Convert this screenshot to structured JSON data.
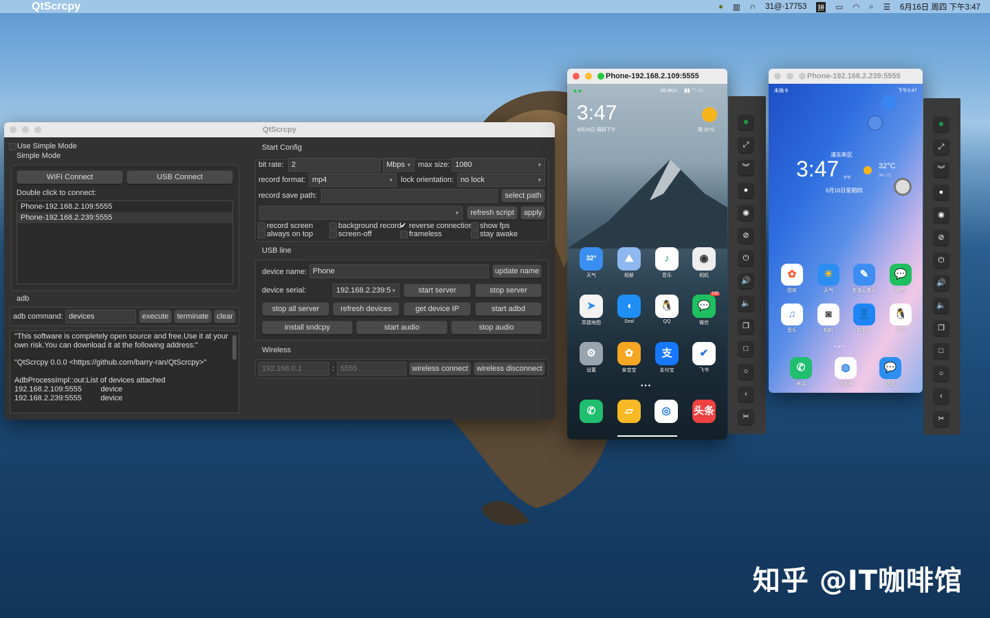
{
  "menubar": {
    "app_name": "QtScrcpy",
    "network": "31@·17753",
    "ime": "拼",
    "datetime": "6月16日 周四 下午3:47"
  },
  "main_window": {
    "title": "QtScrcpy",
    "use_simple_mode": "Use Simple Mode",
    "simple_mode_label": "Simple Mode",
    "wifi_connect": "WIFI Connect",
    "usb_connect": "USB Connect",
    "double_click_hint": "Double click to connect:",
    "devices": [
      "Phone-192.168.2.109:5555",
      "Phone-192.168.2.239:5555"
    ],
    "adb": {
      "section": "adb",
      "command_label": "adb command:",
      "command_value": "devices",
      "execute": "execute",
      "terminate": "terminate",
      "clear": "clear"
    },
    "output": "\"This software is completely open source and free.Use it at your\nown risk.You can download it at the following address:\"\n\n\"QtScrcpy 0.0.0 <https://github.com/barry-ran/QtScrcpy>\"\n\nAdbProcessImpl::out:List of devices attached\n192.168.2.109:5555         device\n192.168.2.239:5555         device",
    "start_config": {
      "section": "Start Config",
      "bit_rate_label": "bit rate:",
      "bit_rate_value": "2",
      "bit_rate_unit": "Mbps",
      "max_size_label": "max size:",
      "max_size_value": "1080",
      "record_format_label": "record format:",
      "record_format_value": "mp4",
      "lock_orientation_label": "lock orientation:",
      "lock_orientation_value": "no lock",
      "record_save_path_label": "record save path:",
      "record_save_path_value": "",
      "select_path": "select path",
      "refresh_script": "refresh script",
      "apply": "apply",
      "checkboxes": {
        "record_screen": {
          "label": "record screen",
          "checked": false
        },
        "background_record": {
          "label": "background record",
          "checked": false
        },
        "reverse_connection": {
          "label": "reverse connectior",
          "checked": true
        },
        "show_fps": {
          "label": "show fps",
          "checked": false
        },
        "always_on_top": {
          "label": "always on top",
          "checked": false
        },
        "screen_off": {
          "label": "screen-off",
          "checked": false
        },
        "frameless": {
          "label": "frameless",
          "checked": false
        },
        "stay_awake": {
          "label": "stay awake",
          "checked": false
        }
      }
    },
    "usb_line": {
      "section": "USB line",
      "device_name_label": "device name:",
      "device_name_value": "Phone",
      "update_name": "update name",
      "device_serial_label": "device serial:",
      "device_serial_value": "192.168.2.239:5",
      "start_server": "start server",
      "stop_server": "stop server",
      "stop_all_server": "stop all server",
      "refresh_devices": "refresh devices",
      "get_device_ip": "get device IP",
      "start_adbd": "start adbd",
      "install_sndcpy": "install sndcpy",
      "start_audio": "start audio",
      "stop_audio": "stop audio"
    },
    "wireless": {
      "section": "Wireless",
      "ip_placeholder": "192.168.0.1",
      "separator": ":",
      "port_placeholder": "5555",
      "connect": "wireless connect",
      "disconnect": "wireless disconnect"
    }
  },
  "phone1": {
    "title": "Phone-192.168.2.109:5555",
    "status_right": "89.9K/s",
    "clock": "3:47",
    "date": "6月16日 周四下午",
    "weather": "晴  32°C",
    "apps": [
      {
        "label": "天气",
        "glyph": "32°",
        "color": "#3a8ef0"
      },
      {
        "label": "相册",
        "glyph": "⛰",
        "color": "#8fb8f0"
      },
      {
        "label": "音乐",
        "glyph": "♪",
        "color": "#ffffff",
        "fg": "#1aa36b"
      },
      {
        "label": "相机",
        "glyph": "◉",
        "color": "#eeeeee",
        "fg": "#333"
      },
      {
        "label": "高德地图",
        "glyph": "➤",
        "color": "#f3f3f3",
        "fg": "#2c8cf0"
      },
      {
        "label": "Seal",
        "glyph": "◖",
        "color": "#1f8ef5"
      },
      {
        "label": "QQ",
        "glyph": "🐧",
        "color": "#ffffff",
        "fg": "#000"
      },
      {
        "label": "微信",
        "glyph": "💬",
        "color": "#1fbf5f",
        "badge": "189"
      },
      {
        "label": "设置",
        "glyph": "⚙",
        "color": "#9aa4ad"
      },
      {
        "label": "亲宝宝",
        "glyph": "✿",
        "color": "#f5a623"
      },
      {
        "label": "支付宝",
        "glyph": "支",
        "color": "#1677ff"
      },
      {
        "label": "飞书",
        "glyph": "✔",
        "color": "#ffffff",
        "fg": "#1e6fe8"
      }
    ],
    "dock": [
      {
        "label": "phone",
        "glyph": "✆",
        "color": "#1fbf6f"
      },
      {
        "label": "messages",
        "glyph": "▱",
        "color": "#f7b924"
      },
      {
        "label": "chrome-beta",
        "glyph": "◎",
        "color": "#ffffff",
        "fg": "#1a73e8"
      },
      {
        "label": "toutiao",
        "glyph": "头条",
        "color": "#f04142"
      }
    ]
  },
  "phone2": {
    "title": "Phone-192.168.2.239:5555",
    "carrier": "未插卡",
    "status_right": "下午3:47",
    "location": "浦东新区",
    "clock": "3:47",
    "ampm": "下午",
    "date": "6月16日星期四",
    "temp": "32°C",
    "temp_range": "34 / 21",
    "apps": [
      {
        "label": "图库",
        "glyph": "✿",
        "color": "#ffffff",
        "fg": "#f0582c"
      },
      {
        "label": "天气",
        "glyph": "☀",
        "color": "#2b8ef0",
        "fg": "#ffc21a"
      },
      {
        "label": "有道云笔记",
        "glyph": "✎",
        "color": "#3d8ef2"
      },
      {
        "label": "微信",
        "glyph": "💬",
        "color": "#1fbf5f"
      },
      {
        "label": "音乐",
        "glyph": "♫",
        "color": "#ffffff",
        "fg": "#4a8ef0"
      },
      {
        "label": "相机",
        "glyph": "◙",
        "color": "#ffffff",
        "fg": "#444"
      },
      {
        "label": "联系人",
        "glyph": "👤",
        "color": "#1f86f5"
      },
      {
        "label": "QQ",
        "glyph": "🐧",
        "color": "#ffffff",
        "fg": "#000"
      }
    ],
    "dock": [
      {
        "label": "电话",
        "glyph": "✆",
        "color": "#1fbf6f"
      },
      {
        "label": "浏览器",
        "glyph": "◍",
        "color": "#ffffff",
        "fg": "#2a7de8"
      },
      {
        "label": "信息",
        "glyph": "💬",
        "color": "#2b8ef0"
      }
    ]
  },
  "toolbar_icons": [
    "app-switch-icon",
    "fullscreen-icon",
    "expand-notification-icon",
    "touch-show-icon",
    "screen-on-icon",
    "screen-off-icon",
    "power-icon",
    "volume-up-icon",
    "volume-down-icon",
    "app-overview-icon",
    "home-icon",
    "circle-home-icon",
    "back-icon",
    "screenshot-icon"
  ],
  "watermark": "知乎 @IT咖啡馆"
}
